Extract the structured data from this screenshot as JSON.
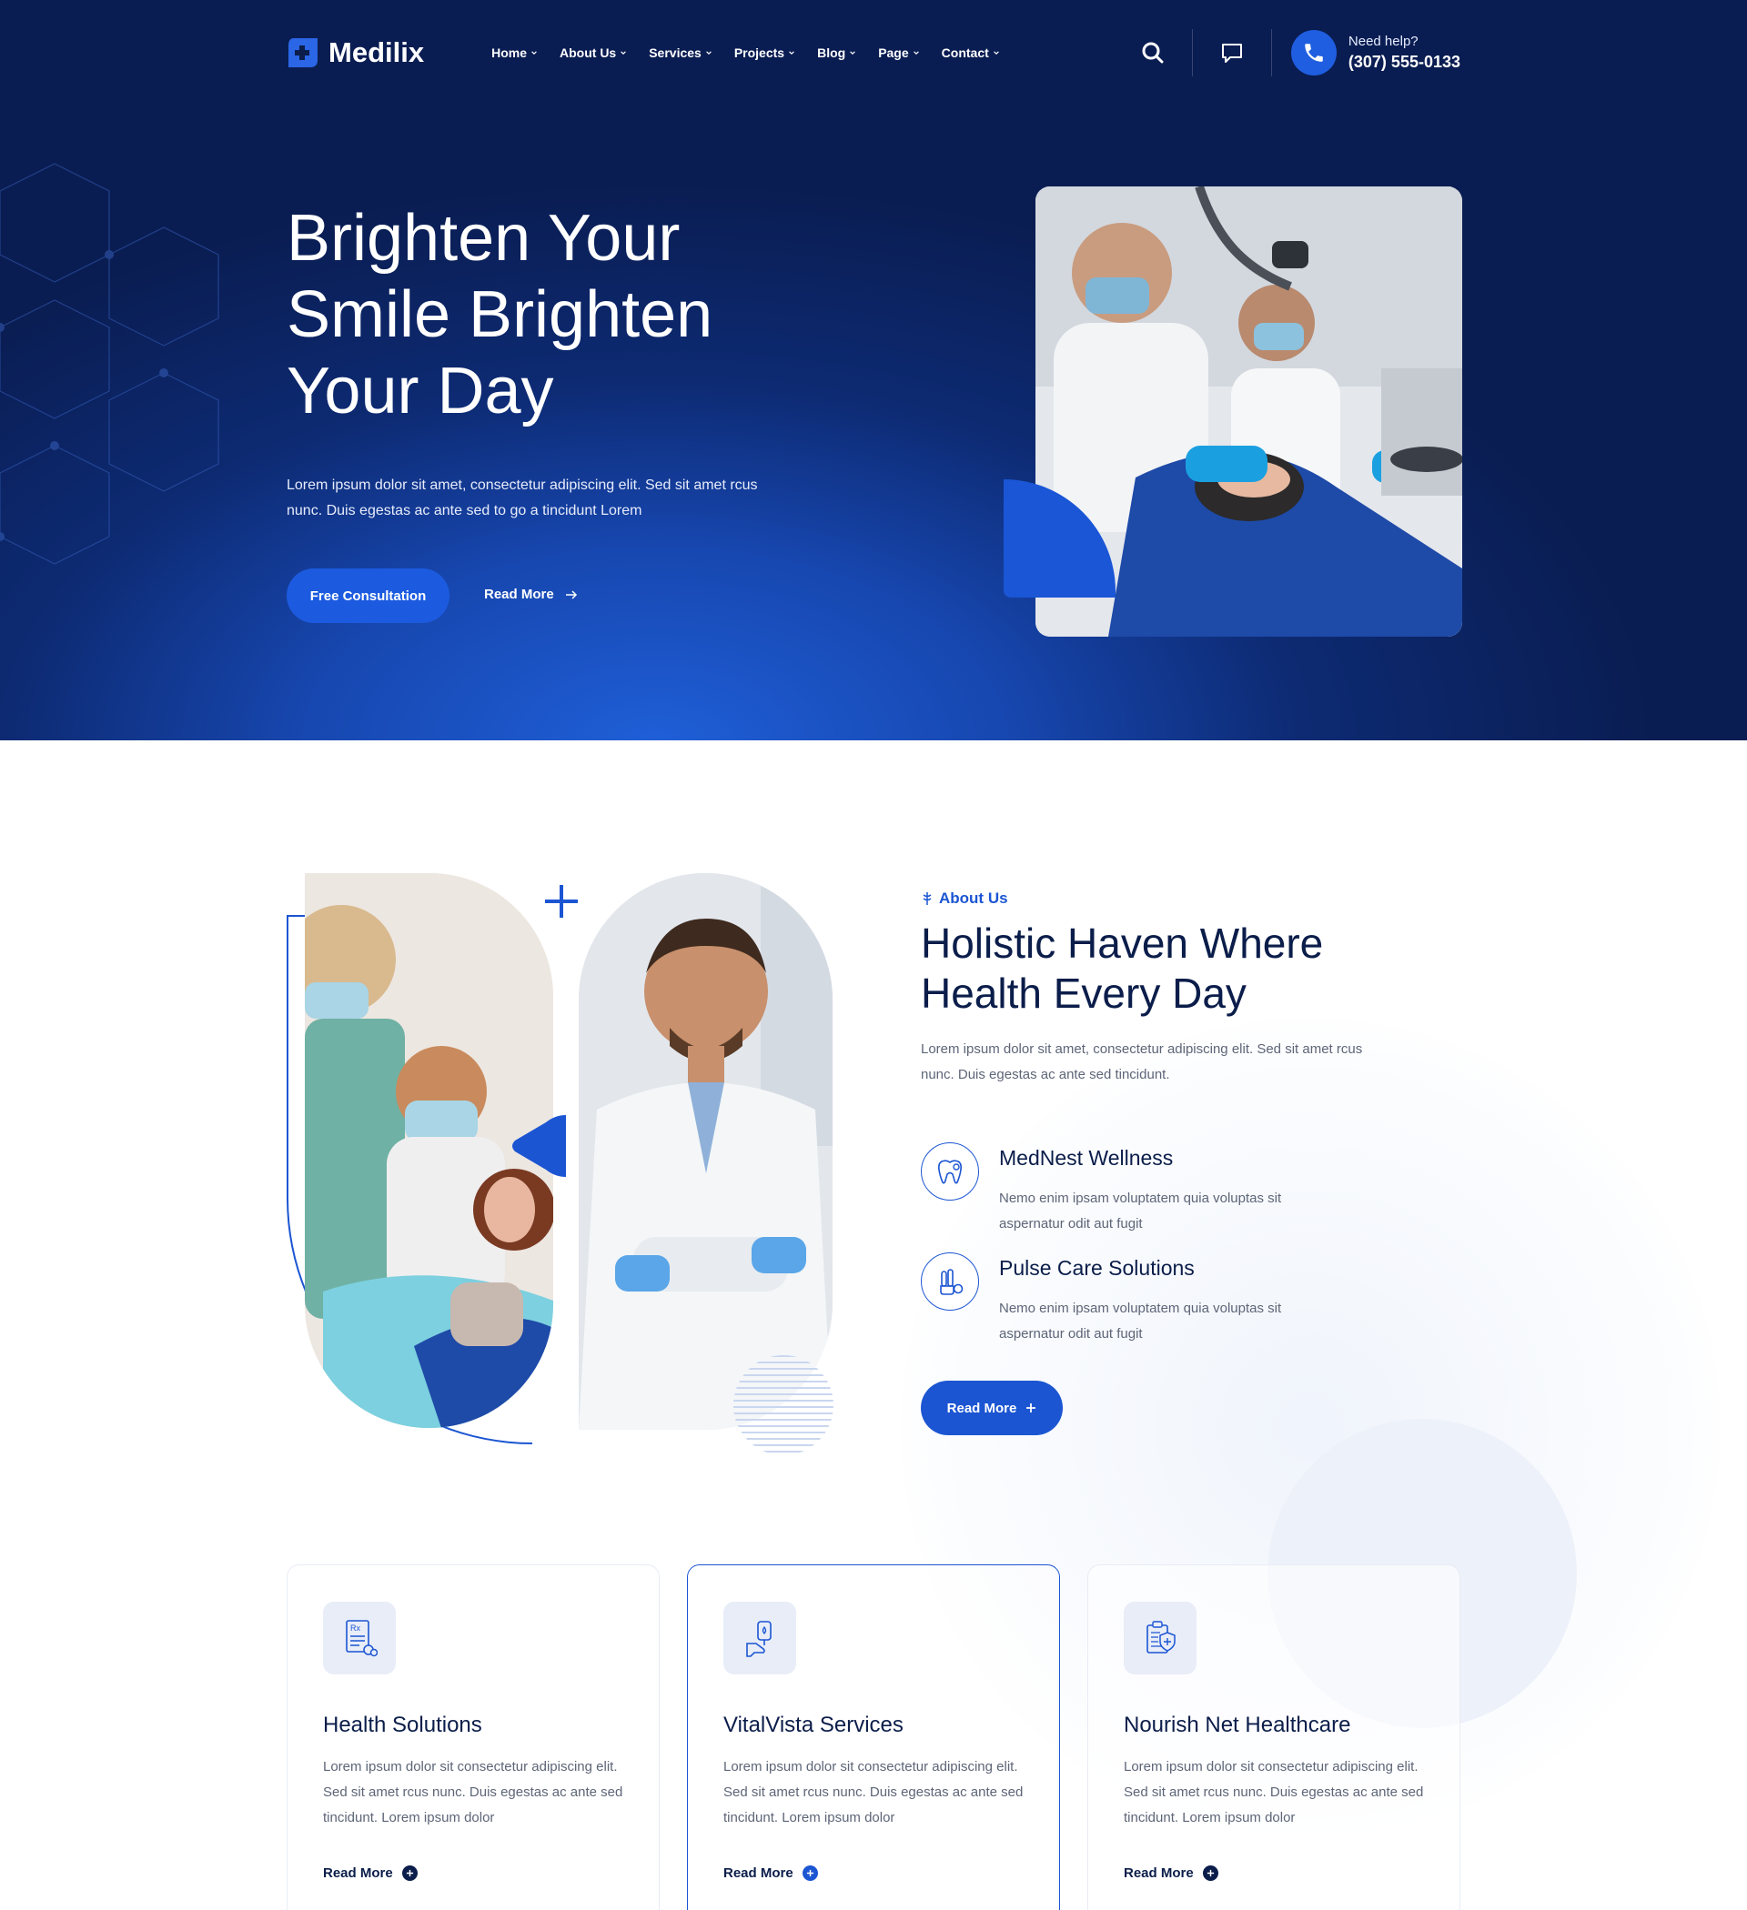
{
  "brand": {
    "name": "Medilix",
    "primary_color": "#1b55d2",
    "navy_color": "#0b1d4a"
  },
  "nav": {
    "items": [
      {
        "label": "Home",
        "icon": "chevron-down-icon"
      },
      {
        "label": "About Us",
        "icon": "chevron-down-icon"
      },
      {
        "label": "Services",
        "icon": "chevron-down-icon"
      },
      {
        "label": "Projects",
        "icon": "chevron-down-icon"
      },
      {
        "label": "Blog",
        "icon": "chevron-down-icon"
      },
      {
        "label": "Page",
        "icon": "chevron-down-icon"
      },
      {
        "label": "Contact",
        "icon": "chevron-down-icon"
      }
    ],
    "search_icon": "search-icon",
    "chat_icon": "chat-icon",
    "phone_icon": "phone-icon",
    "help_label": "Need help?",
    "help_number": "(307) 555-0133"
  },
  "hero": {
    "title": "Brighten Your Smile Brighten Your Day",
    "text": "Lorem ipsum dolor sit amet, consectetur adipiscing elit. Sed sit amet rcus nunc. Duis egestas ac ante sed to go a tincidunt Lorem",
    "cta_label": "Free Consultation",
    "read_more_label": "Read More",
    "image": "dentists-treating-patient-photo"
  },
  "about": {
    "tag": "About Us",
    "title": "Holistic Haven Where Health Every Day",
    "text": "Lorem ipsum dolor sit amet, consectetur adipiscing elit. Sed sit amet rcus nunc. Duis egestas ac ante sed tincidunt.",
    "features": [
      {
        "title": "MedNest Wellness",
        "text": "Nemo enim ipsam voluptatem quia voluptas sit aspernatur odit aut fugit",
        "icon": "tooth-icon"
      },
      {
        "title": "Pulse Care Solutions",
        "text": "Nemo enim ipsam voluptatem quia voluptas sit aspernatur odit aut fugit",
        "icon": "medical-tools-icon"
      }
    ],
    "button_label": "Read More",
    "images": [
      "dental-checkup-photo",
      "smiling-dentist-photo"
    ]
  },
  "services": [
    {
      "title": "Health Solutions",
      "text": "Lorem ipsum dolor sit consectetur adipiscing elit. Sed sit amet rcus nunc. Duis egestas ac ante sed tincidunt. Lorem ipsum dolor",
      "link": "Read More",
      "icon": "prescription-icon"
    },
    {
      "title": "VitalVista Services",
      "text": "Lorem ipsum dolor sit consectetur adipiscing elit. Sed sit amet rcus nunc. Duis egestas ac ante sed tincidunt. Lorem ipsum dolor",
      "link": "Read More",
      "icon": "blood-bag-icon"
    },
    {
      "title": "Nourish Net Healthcare",
      "text": "Lorem ipsum dolor sit consectetur adipiscing elit. Sed sit amet rcus nunc. Duis egestas ac ante sed tincidunt. Lorem ipsum dolor",
      "link": "Read More",
      "icon": "medical-report-icon"
    }
  ]
}
